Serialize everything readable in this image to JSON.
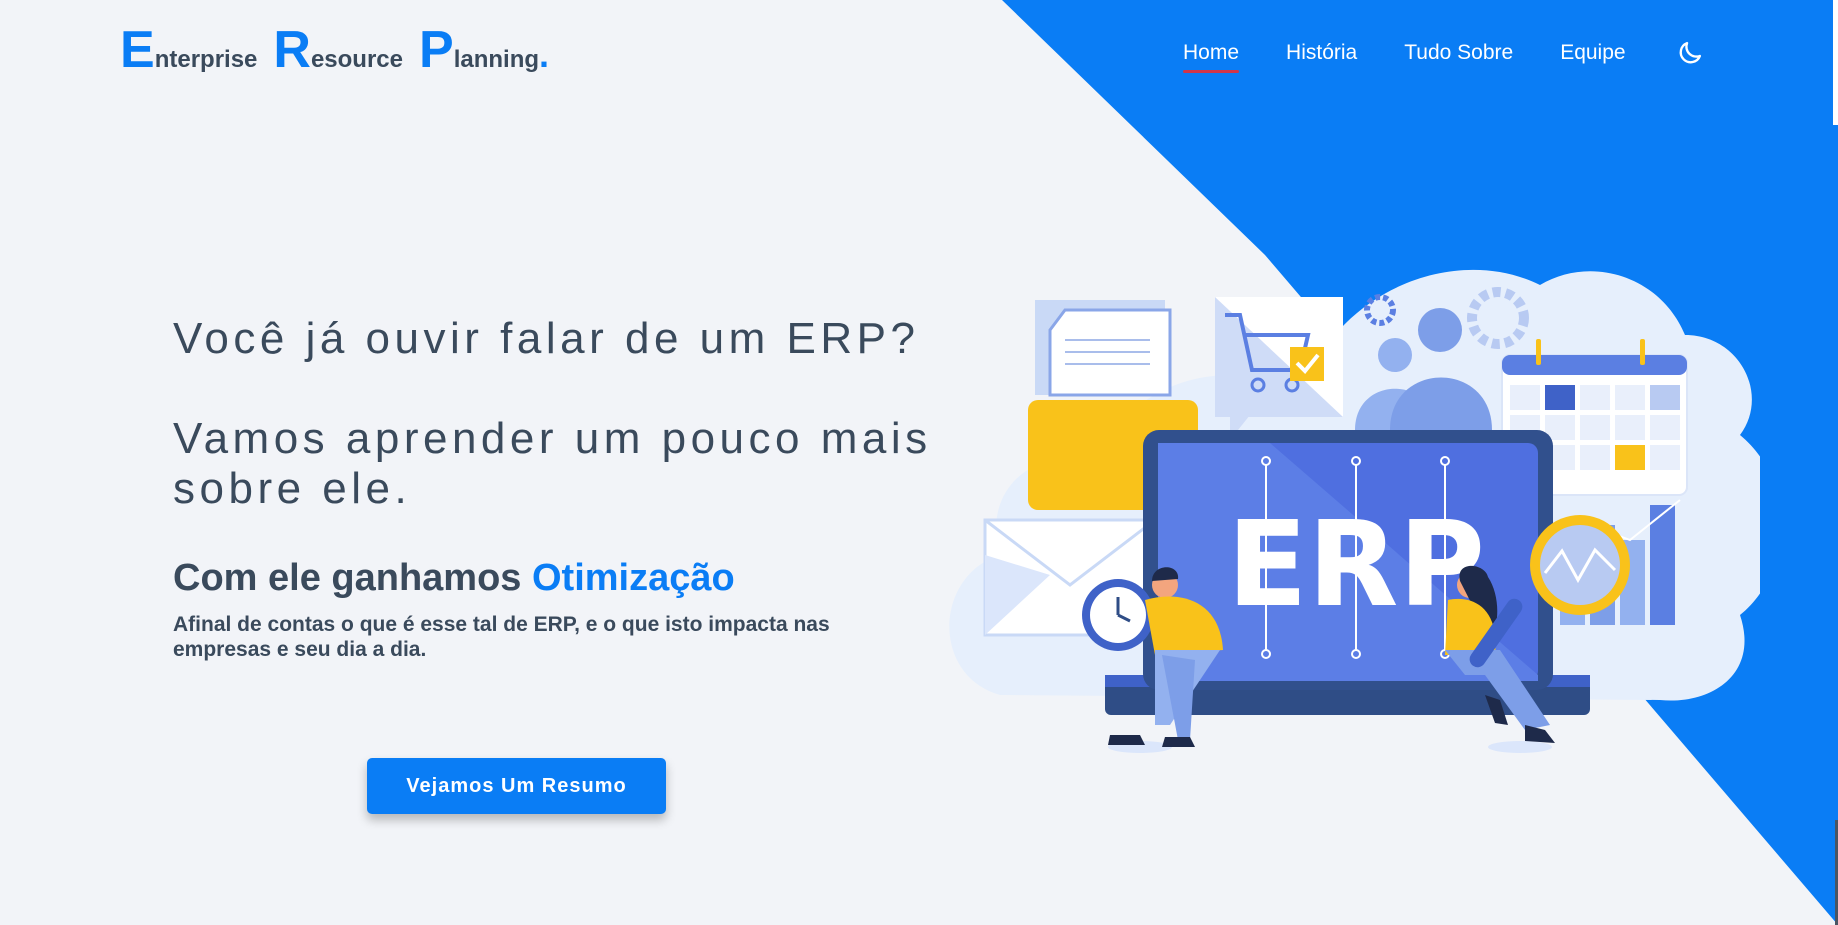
{
  "logo": {
    "e_big": "E",
    "e_rest": "nterprise",
    "r_big": "R",
    "r_rest": "esource",
    "p_big": "P",
    "p_rest": "lanning",
    "dot": "."
  },
  "nav": {
    "items": [
      {
        "label": "Home",
        "active": true
      },
      {
        "label": "História",
        "active": false
      },
      {
        "label": "Tudo Sobre",
        "active": false
      },
      {
        "label": "Equipe",
        "active": false
      }
    ],
    "theme_toggle_icon": "moon-icon"
  },
  "hero": {
    "line1": "Você já ouvir falar de um ERP?",
    "line2": "Vamos aprender um pouco mais sobre ele.",
    "sub_prefix": "Com ele ganhamos ",
    "sub_accent": "Otimização",
    "description": "Afinal de contas o que é esse tal de ERP, e o que isto impacta nas empresas e seu dia a dia.",
    "cta_label": "Vejamos Um Resumo"
  },
  "illustration": {
    "screen_text": "ERP"
  },
  "colors": {
    "accent": "#0a7df5",
    "text": "#3a4a5c",
    "background": "#f2f4f8",
    "nav_underline": "#d0364a",
    "illustration_yellow": "#f9c21a"
  }
}
